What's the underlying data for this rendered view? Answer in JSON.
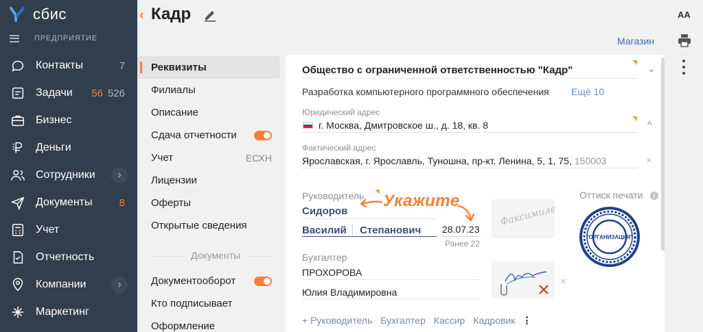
{
  "app": {
    "logo_text": "сбис",
    "org_label": "ПРЕДПРИЯТИЕ"
  },
  "nav": [
    {
      "label": "Контакты",
      "icon": "chat-icon",
      "badge": "7"
    },
    {
      "label": "Задачи",
      "icon": "tasks-icon",
      "badge_orange": "56",
      "badge_gray": "526"
    },
    {
      "label": "Бизнес",
      "icon": "briefcase-icon"
    },
    {
      "label": "Деньги",
      "icon": "ruble-icon"
    },
    {
      "label": "Сотрудники",
      "icon": "people-icon",
      "chevron": "›"
    },
    {
      "label": "Документы",
      "icon": "paper-plane-icon",
      "badge_orange_single": "8"
    },
    {
      "label": "Учет",
      "icon": "calculator-icon"
    },
    {
      "label": "Отчетность",
      "icon": "report-icon"
    },
    {
      "label": "Компании",
      "icon": "location-icon",
      "chevron": "›"
    },
    {
      "label": "Маркетинг",
      "icon": "spark-icon"
    }
  ],
  "header": {
    "back": "‹",
    "title": "Кадр",
    "shop_link": "Магазин",
    "font_size_toggle": "AA"
  },
  "sections": {
    "items": [
      "Реквизиты",
      "Филиалы",
      "Описание",
      "Сдача отчетности",
      "Учет",
      "Лицензии",
      "Оферты",
      "Открытые сведения"
    ],
    "uchet_value": "ЕСХН",
    "group_label": "Документы",
    "doc_items": [
      "Документооборот",
      "Кто подписывает",
      "Оформление"
    ]
  },
  "card": {
    "company_name": "Общество с ограниченной ответственностью \"Кадр\"",
    "activity": "Разработка компьютерного программного обеспечения",
    "more_link": "Ещё 10",
    "legal_address_label": "Юридический адрес",
    "legal_address": "г. Москва, Дмитровское ш., д. 18, кв. 8",
    "actual_address_label": "Фактический адрес",
    "actual_address": "Ярославская, г. Ярославль, Туношна, пр-кт. Ленина, 5, 1, 75,",
    "actual_zip": "150003",
    "director_label": "Руководитель",
    "director_surname": "Сидоров",
    "director_name": "Василий",
    "director_patronymic": "Степанович",
    "hint": "Укажите",
    "date": "28.07.23",
    "earlier": "Ранее 22",
    "facsimile_text": "Факсимиле",
    "stamp_label": "Оттиск печати",
    "stamp_text": "\"ОРГАНИЗАЦИЯ\"",
    "accountant_label": "Бухгалтер",
    "accountant_surname": "ПРОХОРОВА",
    "accountant_name": "Юлия Владимировна",
    "add_links": [
      "+ Руководитель",
      "Бухгалтер",
      "Кассир",
      "Кадровик"
    ]
  },
  "colors": {
    "accent": "#f57f3a",
    "sidebar": "#313e4d",
    "link": "#3c6bb0"
  }
}
